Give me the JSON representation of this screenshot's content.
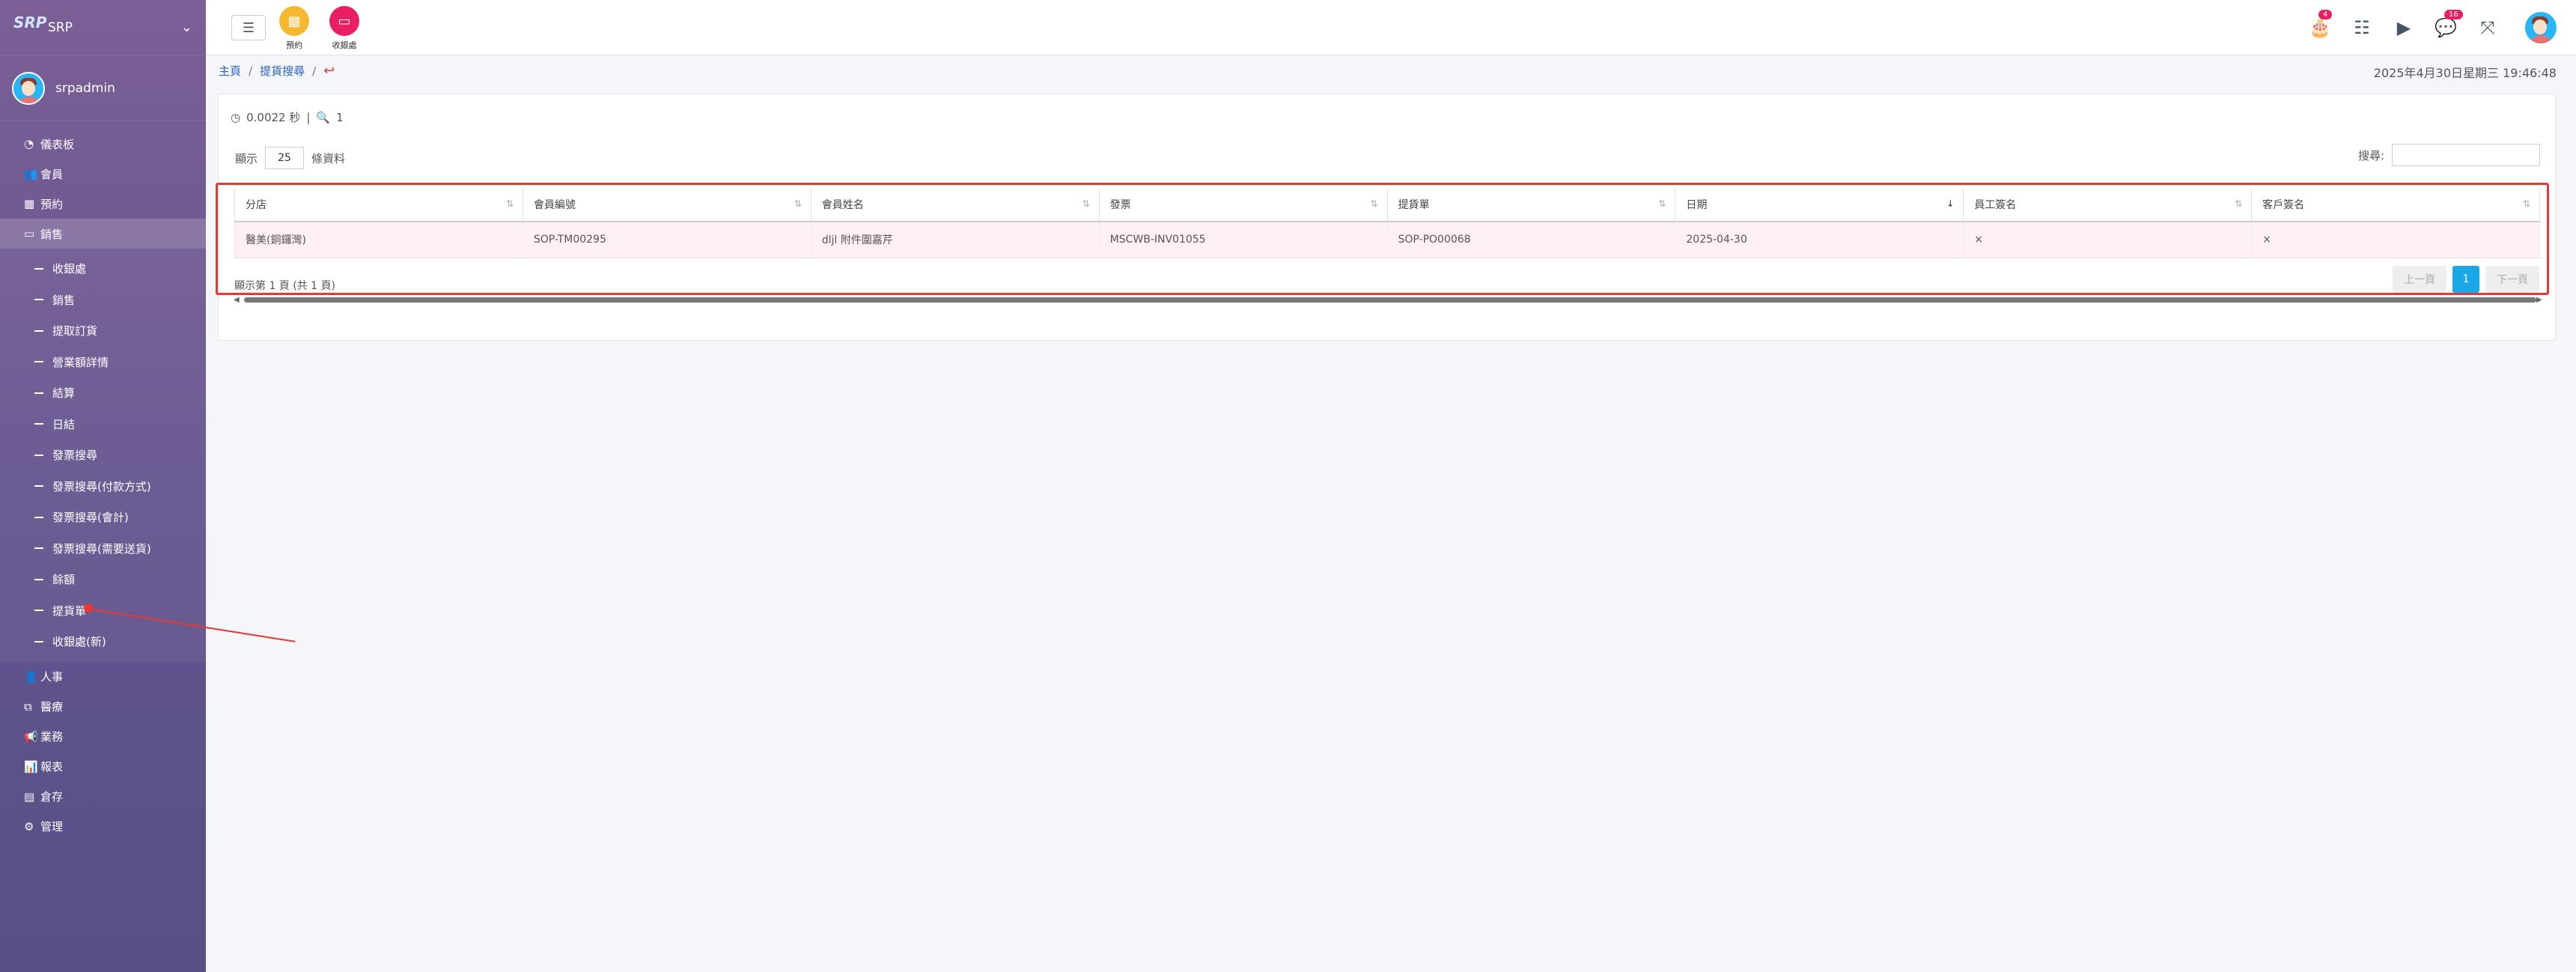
{
  "brand": {
    "logo": "SRP",
    "name": "SRP"
  },
  "user": {
    "name": "srpadmin"
  },
  "sidebar": {
    "items": [
      {
        "label": "儀表板",
        "icon": "dashboard-icon"
      },
      {
        "label": "會員",
        "icon": "users-icon"
      },
      {
        "label": "預約",
        "icon": "calendar-icon"
      },
      {
        "label": "銷售",
        "icon": "money-icon",
        "active": true
      }
    ],
    "subitems": [
      "收銀處",
      "銷售",
      "提取訂貨",
      "營業額詳情",
      "結算",
      "日結",
      "發票搜尋",
      "發票搜尋(付款方式)",
      "發票搜尋(會計)",
      "發票搜尋(需要送貨)",
      "餘額",
      "提貨單",
      "收銀處(新)"
    ],
    "items2": [
      {
        "label": "人事",
        "icon": "person-icon"
      },
      {
        "label": "醫療",
        "icon": "medical-icon"
      },
      {
        "label": "業務",
        "icon": "megaphone-icon"
      },
      {
        "label": "報表",
        "icon": "chart-icon"
      },
      {
        "label": "倉存",
        "icon": "warehouse-icon"
      },
      {
        "label": "管理",
        "icon": "gear-icon"
      }
    ]
  },
  "topbar": {
    "quick": [
      {
        "label": "預約",
        "color": "#f5b82e"
      },
      {
        "label": "收銀處",
        "color": "#e91e63"
      }
    ],
    "badges": {
      "birthday": "4",
      "chat": "16"
    }
  },
  "breadcrumb": {
    "home": "主頁",
    "page": "提貨搜尋"
  },
  "datetime": "2025年4月30日星期三 19:46:48",
  "timing": {
    "seconds": "0.0022 秒",
    "count": "1"
  },
  "show": {
    "prefix": "顯示",
    "value": "25",
    "suffix": "條資料"
  },
  "search": {
    "label": "搜尋:"
  },
  "table": {
    "headers": [
      "分店",
      "會員編號",
      "會員姓名",
      "發票",
      "提貨單",
      "日期",
      "員工簽名",
      "客戶簽名"
    ],
    "rows": [
      [
        "醫美(銅鑼灣)",
        "SOP-TM00295",
        "dljl 附件圍嘉芹",
        "MSCWB-INV01055",
        "SOP-PO00068",
        "2025-04-30",
        "×",
        "×"
      ]
    ]
  },
  "info": "顯示第 1 頁 (共 1 頁)",
  "pager": {
    "prev": "上一頁",
    "page": "1",
    "next": "下一頁"
  }
}
